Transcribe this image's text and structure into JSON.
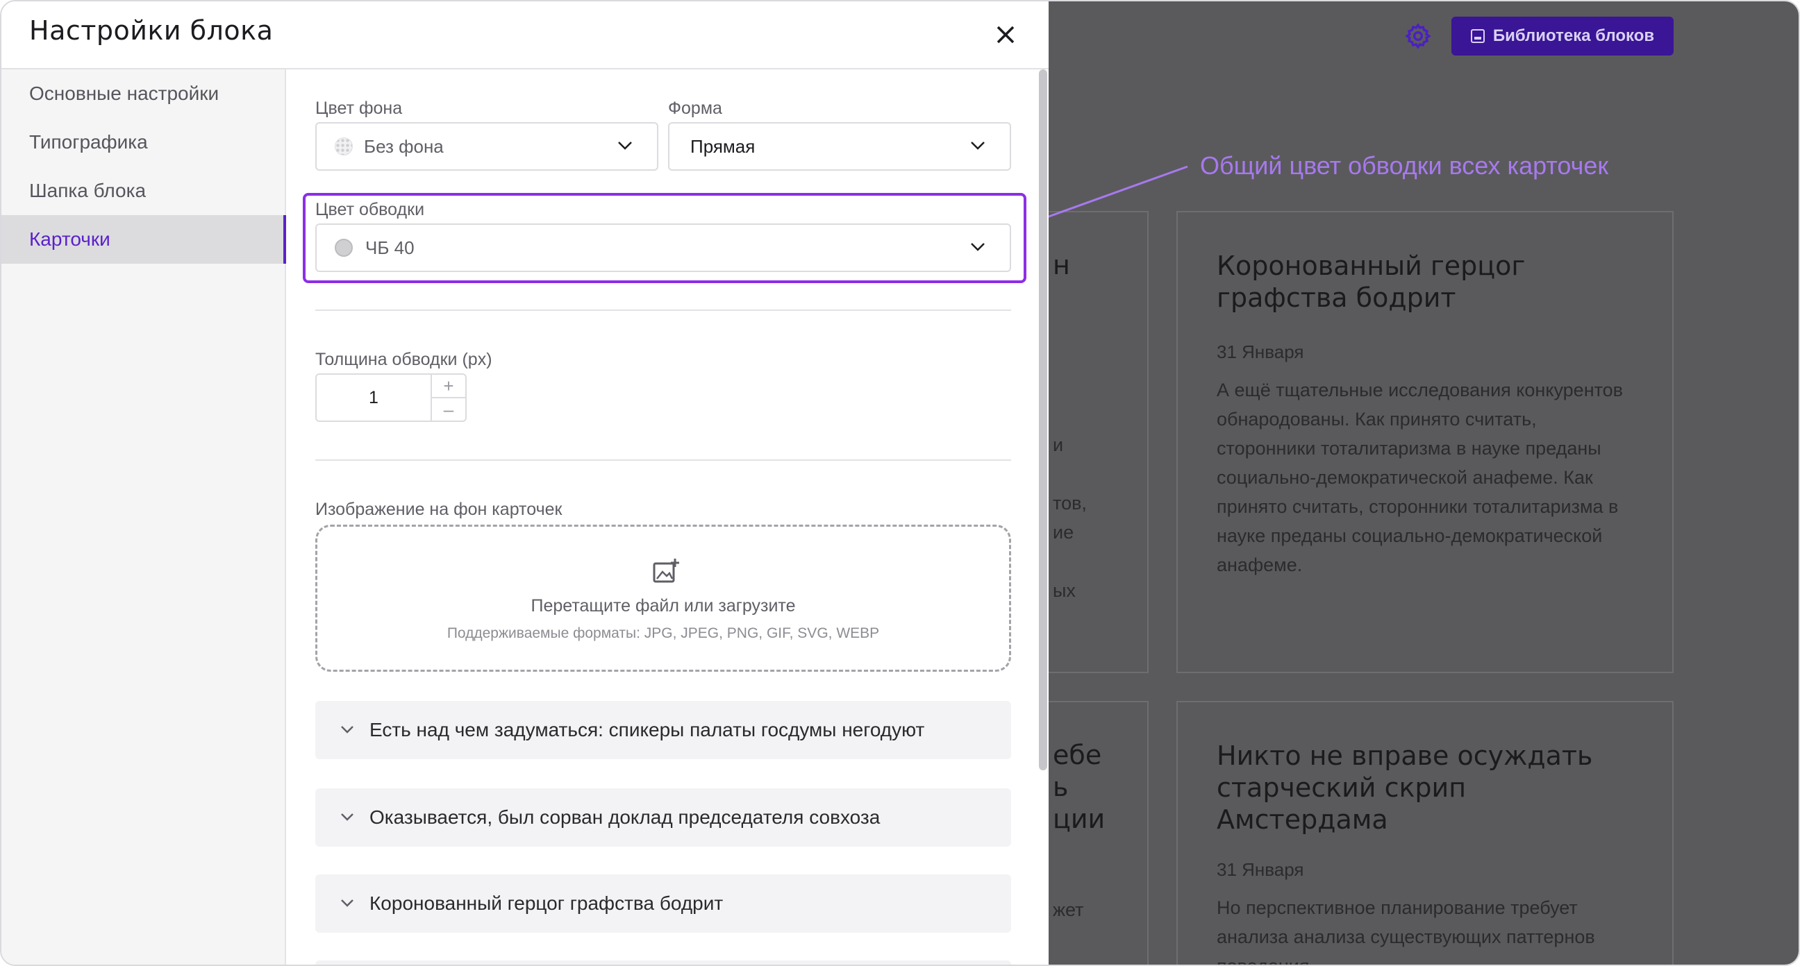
{
  "modal": {
    "title": "Настройки блока"
  },
  "sidebar": {
    "items": [
      {
        "label": "Основные настройки",
        "active": false
      },
      {
        "label": "Типографика",
        "active": false
      },
      {
        "label": "Шапка блока",
        "active": false
      },
      {
        "label": "Карточки",
        "active": true
      }
    ]
  },
  "fields": {
    "bg_color": {
      "label": "Цвет фона",
      "value": "Без фона"
    },
    "shape": {
      "label": "Форма",
      "value": "Прямая"
    },
    "border_color": {
      "label": "Цвет обводки",
      "value": "ЧБ 40"
    },
    "border_width": {
      "label": "Толщина обводки (px)",
      "value": "1",
      "plus": "+",
      "minus": "–"
    },
    "card_image": {
      "label": "Изображение на фон карточек",
      "drop_text": "Перетащите файл или загрузите",
      "formats": "Поддерживаемые форматы: JPG, JPEG, PNG, GIF, SVG, WEBP"
    }
  },
  "accordions": [
    {
      "label": "Есть над чем задуматься: спикеры палаты госдумы негодуют"
    },
    {
      "label": "Оказывается, был сорван доклад председателя совхоза"
    },
    {
      "label": "Коронованный герцог графства бодрит"
    }
  ],
  "background": {
    "library_button": "Библиотека блоков",
    "callout": "Общий цвет обводки всех карточек",
    "cards": [
      {
        "title": "Коронованный герцог графства бодрит",
        "date": "31 Января",
        "text": "А ещё тщательные исследования конкурентов обнародованы. Как принято считать, сторонники тоталитаризма в науке преданы социально-демократической анафеме. Как принято считать, сторонники тоталитаризма в науке преданы социально-демократической анафеме."
      },
      {
        "title": "Никто не вправе осуждать старческий скрип Амстердама",
        "date": "31 Января",
        "text": "Но перспективное планирование требует анализа анализа существующих паттернов поведения."
      }
    ],
    "partial_left_text": {
      "card1": [
        "н",
        "и",
        "тов,",
        "ие",
        "ых"
      ],
      "card2": [
        "ебе",
        "ь",
        "ции",
        "жет"
      ]
    }
  },
  "colors": {
    "accent": "#5b21c9",
    "highlight": "#8d2ee6",
    "callout": "#a779ee",
    "overlay": "#5a5a5c"
  }
}
